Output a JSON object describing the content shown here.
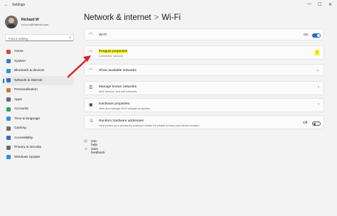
{
  "titlebar": {
    "title": "Settings",
    "back": "←",
    "min": "—",
    "max": "☐",
    "close": "✕"
  },
  "user": {
    "name": "Richard W",
    "email": "r••••••••@hotmail.com"
  },
  "search": {
    "placeholder": "Find a setting"
  },
  "nav": [
    {
      "label": "Home",
      "color": "#d04a3a"
    },
    {
      "label": "System",
      "color": "#3a78c9"
    },
    {
      "label": "Bluetooth & devices",
      "color": "#2f8fd8"
    },
    {
      "label": "Network & internet",
      "color": "#2f6fb8"
    },
    {
      "label": "Personalization",
      "color": "#c77b2b"
    },
    {
      "label": "Apps",
      "color": "#5d6b7a"
    },
    {
      "label": "Accounts",
      "color": "#2fa35a"
    },
    {
      "label": "Time & language",
      "color": "#2f8fd8"
    },
    {
      "label": "Gaming",
      "color": "#6b6b6b"
    },
    {
      "label": "Accessibility",
      "color": "#2f6fb8"
    },
    {
      "label": "Privacy & security",
      "color": "#6b6b6b"
    },
    {
      "label": "Windows Update",
      "color": "#2f8fd8"
    }
  ],
  "breadcrumb": {
    "parent": "Network & internet",
    "sep": ">",
    "current": "Wi-Fi"
  },
  "wifi": {
    "label": "Wi-Fi",
    "state": "On"
  },
  "network": {
    "name": "Penguin properties",
    "status": "Connected, secured"
  },
  "available": {
    "label": "Show available networks"
  },
  "known": {
    "title": "Manage known networks",
    "subtitle": "Add, remove, and edit networks"
  },
  "hardware": {
    "title": "Hardware properties",
    "subtitle": "View and manage Wi-Fi adapter properties"
  },
  "random": {
    "title": "Random hardware addresses",
    "subtitle": "Help protect your privacy by making it harder for people to track your device location",
    "state": "Off"
  },
  "links": {
    "help": "Get help",
    "feedback": "Give feedback"
  },
  "colors": {
    "accent": "#1f6dcc",
    "highlight": "#fff200",
    "arrow": "#e02020"
  }
}
